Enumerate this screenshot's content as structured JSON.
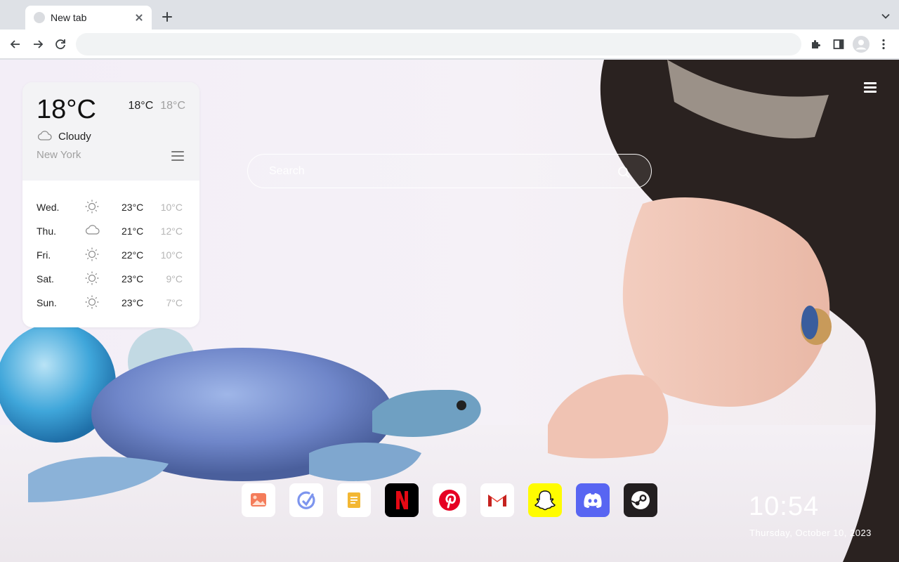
{
  "browser": {
    "tab_title": "New tab",
    "omnibox_value": ""
  },
  "weather": {
    "current_temp": "18°C",
    "high": "18°C",
    "low": "18°C",
    "condition": "Cloudy",
    "city": "New York",
    "forecast": [
      {
        "day": "Wed.",
        "icon": "sun-icon",
        "high": "23°C",
        "low": "10°C"
      },
      {
        "day": "Thu.",
        "icon": "cloud-icon",
        "high": "21°C",
        "low": "12°C"
      },
      {
        "day": "Fri.",
        "icon": "sun-icon",
        "high": "22°C",
        "low": "10°C"
      },
      {
        "day": "Sat.",
        "icon": "sun-icon",
        "high": "23°C",
        "low": "9°C"
      },
      {
        "day": "Sun.",
        "icon": "sun-icon",
        "high": "23°C",
        "low": "7°C"
      }
    ]
  },
  "search": {
    "placeholder": "Search"
  },
  "dock": {
    "apps": [
      {
        "name": "photos-app-icon",
        "color": "#f26b4b"
      },
      {
        "name": "task-app-icon",
        "color": "#6f8ff0"
      },
      {
        "name": "notes-app-icon",
        "color": "#f0b429"
      },
      {
        "name": "netflix-app-icon",
        "color": "#e50914"
      },
      {
        "name": "pinterest-app-icon",
        "color": "#e60023"
      },
      {
        "name": "gmail-app-icon",
        "color": "#ea4335"
      },
      {
        "name": "snapchat-app-icon",
        "color": "#fffc00"
      },
      {
        "name": "discord-app-icon",
        "color": "#5865f2"
      },
      {
        "name": "steam-app-icon",
        "color": "#231f20"
      }
    ]
  },
  "clock": {
    "time": "10:54",
    "date": "Thursday, October 10, 2023"
  }
}
